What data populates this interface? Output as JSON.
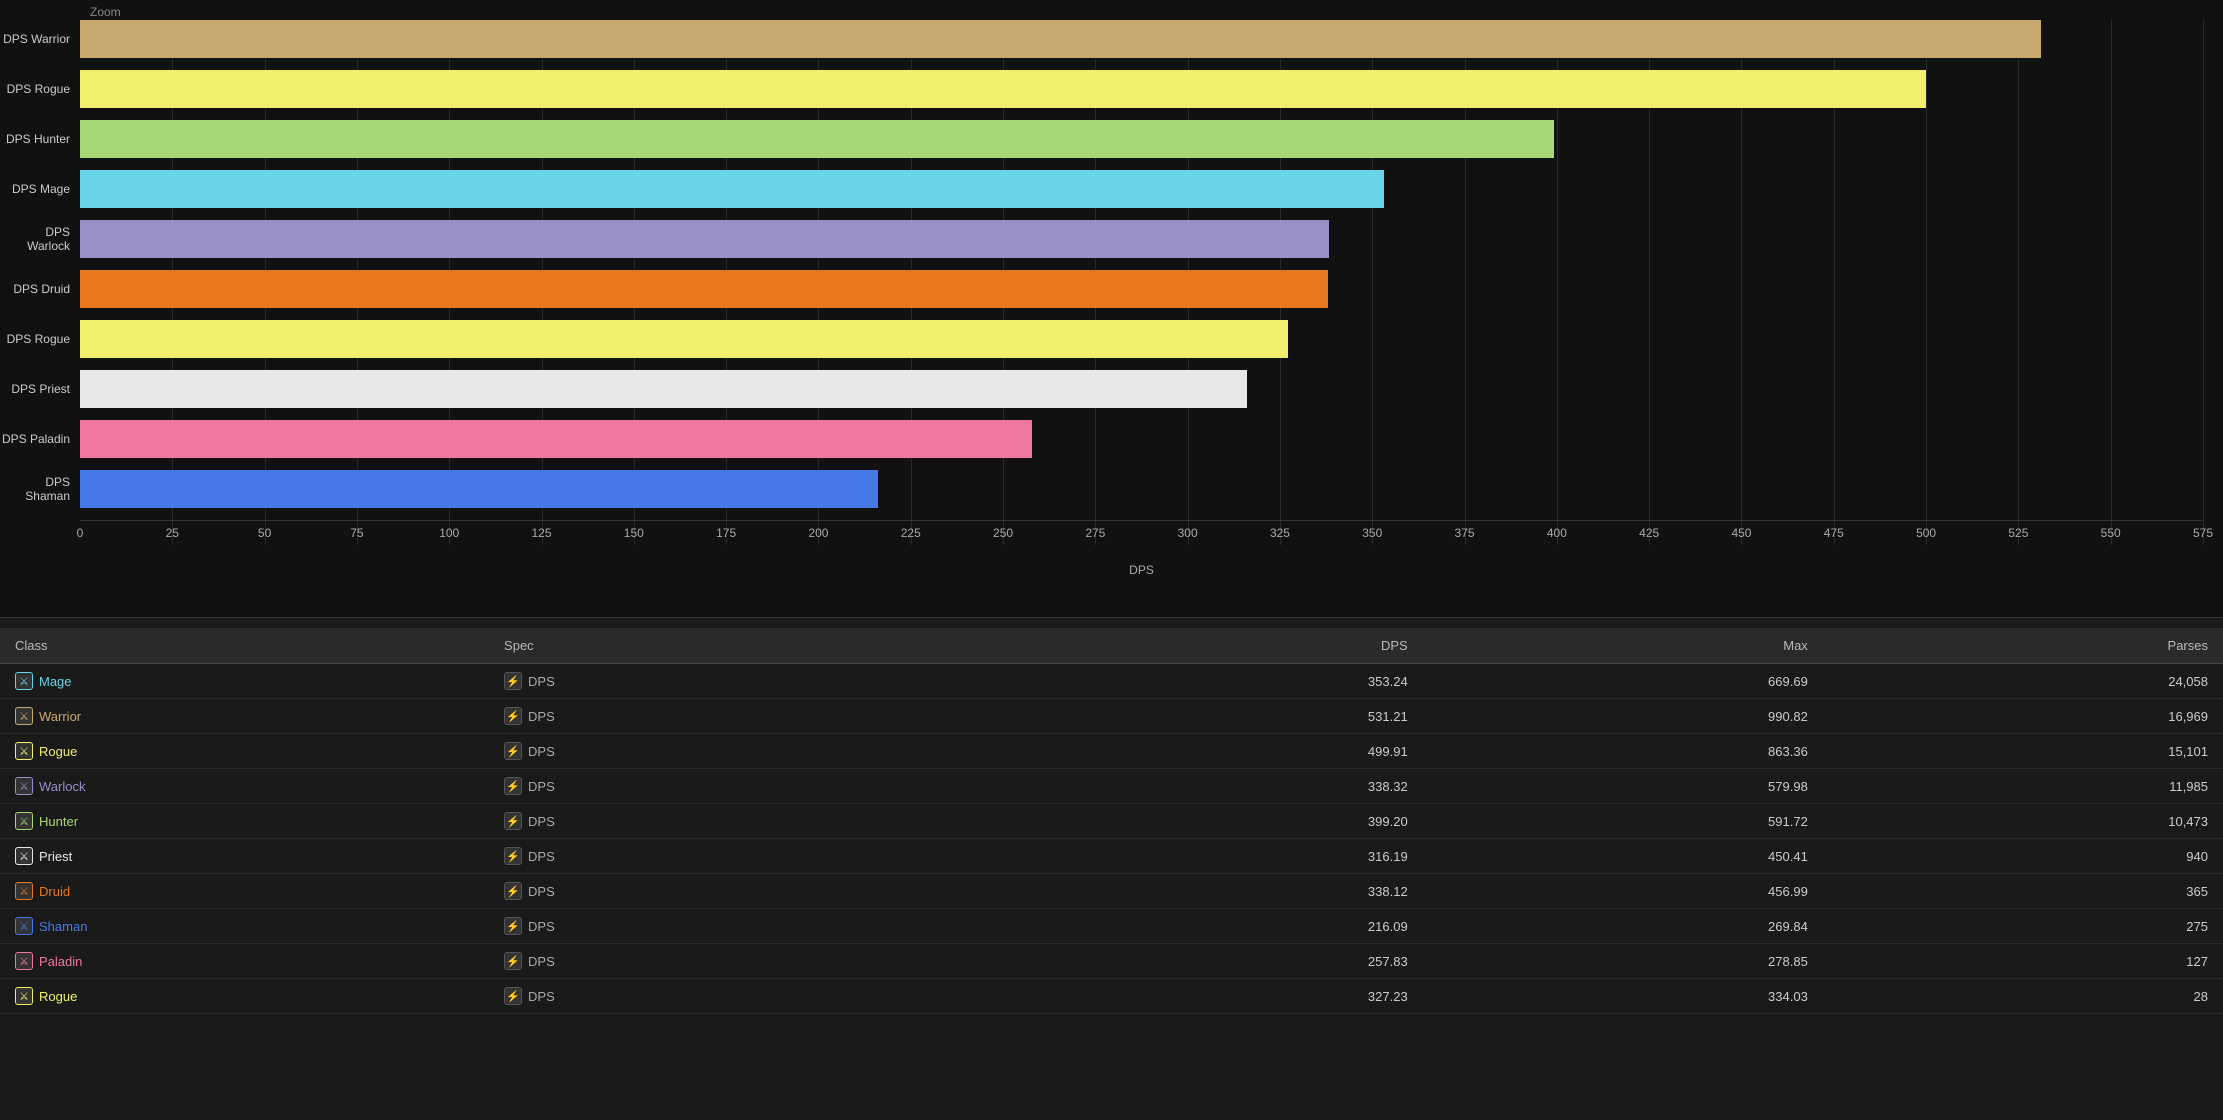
{
  "chart": {
    "zoom_label": "Zoom",
    "x_axis_title": "DPS",
    "x_ticks": [
      0,
      25,
      50,
      75,
      100,
      125,
      150,
      175,
      200,
      225,
      250,
      275,
      300,
      325,
      350,
      375,
      400,
      425,
      450,
      475,
      500,
      525,
      550,
      575
    ],
    "max_value": 575,
    "bars": [
      {
        "label": "DPS Warrior",
        "value": 531.21,
        "color": "#c8a96e"
      },
      {
        "label": "DPS Rogue",
        "value": 499.91,
        "color": "#f0f06e"
      },
      {
        "label": "DPS Hunter",
        "value": 399.2,
        "color": "#a8d875"
      },
      {
        "label": "DPS Mage",
        "value": 353.24,
        "color": "#68d4e8"
      },
      {
        "label": "DPS Warlock",
        "value": 338.32,
        "color": "#9b8fc8"
      },
      {
        "label": "DPS Druid",
        "value": 338.12,
        "color": "#e87820"
      },
      {
        "label": "DPS Rogue",
        "value": 327.23,
        "color": "#f0f06e"
      },
      {
        "label": "DPS Priest",
        "value": 316.19,
        "color": "#e8e8e8"
      },
      {
        "label": "DPS Paladin",
        "value": 257.83,
        "color": "#f078a0"
      },
      {
        "label": "DPS Shaman",
        "value": 216.09,
        "color": "#4878e8"
      }
    ]
  },
  "table": {
    "headers": [
      "Class",
      "Spec",
      "DPS",
      "Max",
      "Parses"
    ],
    "rows": [
      {
        "class": "Mage",
        "class_color": "#68d4e8",
        "spec": "DPS",
        "dps": "353.24",
        "max": "669.69",
        "parses": "24,058"
      },
      {
        "class": "Warrior",
        "class_color": "#c8a96e",
        "spec": "DPS",
        "dps": "531.21",
        "max": "990.82",
        "parses": "16,969"
      },
      {
        "class": "Rogue",
        "class_color": "#f0f06e",
        "spec": "DPS",
        "dps": "499.91",
        "max": "863.36",
        "parses": "15,101"
      },
      {
        "class": "Warlock",
        "class_color": "#9b8fc8",
        "spec": "DPS",
        "dps": "338.32",
        "max": "579.98",
        "parses": "11,985"
      },
      {
        "class": "Hunter",
        "class_color": "#a8d875",
        "spec": "DPS",
        "dps": "399.20",
        "max": "591.72",
        "parses": "10,473"
      },
      {
        "class": "Priest",
        "class_color": "#e8e8e8",
        "spec": "DPS",
        "dps": "316.19",
        "max": "450.41",
        "parses": "940"
      },
      {
        "class": "Druid",
        "class_color": "#e87820",
        "spec": "DPS",
        "dps": "338.12",
        "max": "456.99",
        "parses": "365"
      },
      {
        "class": "Shaman",
        "class_color": "#4878e8",
        "spec": "DPS",
        "dps": "216.09",
        "max": "269.84",
        "parses": "275"
      },
      {
        "class": "Paladin",
        "class_color": "#f078a0",
        "spec": "DPS",
        "dps": "257.83",
        "max": "278.85",
        "parses": "127"
      },
      {
        "class": "Rogue",
        "class_color": "#f0f06e",
        "spec": "DPS",
        "dps": "327.23",
        "max": "334.03",
        "parses": "28"
      }
    ]
  }
}
